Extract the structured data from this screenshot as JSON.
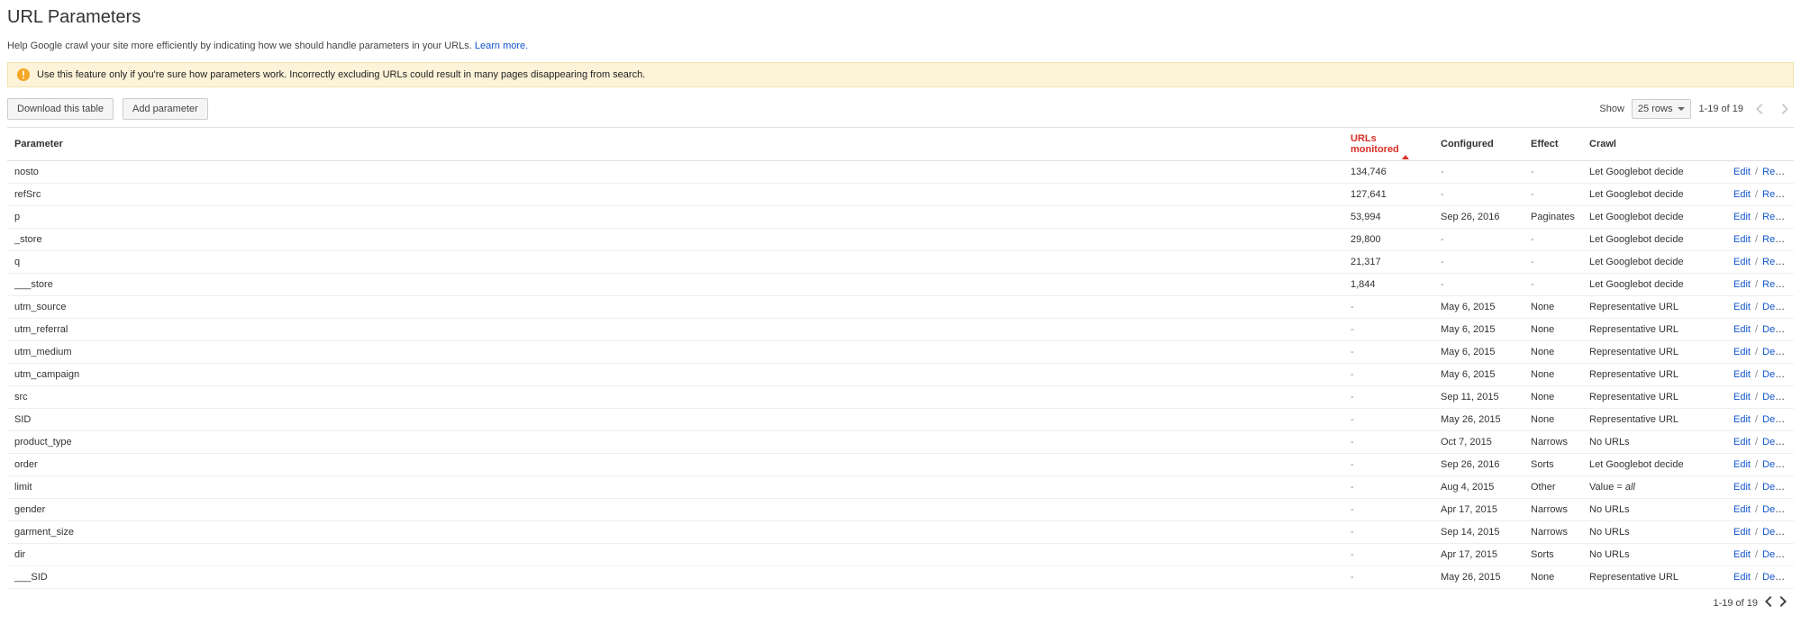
{
  "page": {
    "title": "URL Parameters",
    "intro_text": "Help Google crawl your site more efficiently by indicating how we should handle parameters in your URLs. ",
    "learn_more": "Learn more.",
    "warning": "Use this feature only if you're sure how parameters work. Incorrectly excluding URLs could result in many pages disappearing from search."
  },
  "toolbar": {
    "download": "Download this table",
    "add": "Add parameter"
  },
  "pager": {
    "show_label": "Show",
    "rows_value": "25 rows",
    "range": "1-19 of 19"
  },
  "headers": {
    "parameter": "Parameter",
    "urls_monitored": "URLs monitored",
    "configured": "Configured",
    "effect": "Effect",
    "crawl": "Crawl"
  },
  "action_labels": {
    "edit": "Edit",
    "reset": "Reset",
    "delete": "Delete",
    "sep": "/"
  },
  "crawl_value_prefix": "Value = ",
  "rows": [
    {
      "param": "nosto",
      "urls": "134,746",
      "configured": "-",
      "effect": "-",
      "crawl": "Let Googlebot decide",
      "alt": "Reset"
    },
    {
      "param": "refSrc",
      "urls": "127,641",
      "configured": "-",
      "effect": "-",
      "crawl": "Let Googlebot decide",
      "alt": "Reset"
    },
    {
      "param": "p",
      "urls": "53,994",
      "configured": "Sep 26, 2016",
      "effect": "Paginates",
      "crawl": "Let Googlebot decide",
      "alt": "Reset"
    },
    {
      "param": "_store",
      "urls": "29,800",
      "configured": "-",
      "effect": "-",
      "crawl": "Let Googlebot decide",
      "alt": "Reset"
    },
    {
      "param": "q",
      "urls": "21,317",
      "configured": "-",
      "effect": "-",
      "crawl": "Let Googlebot decide",
      "alt": "Reset"
    },
    {
      "param": "___store",
      "urls": "1,844",
      "configured": "-",
      "effect": "-",
      "crawl": "Let Googlebot decide",
      "alt": "Reset"
    },
    {
      "param": "utm_source",
      "urls": "-",
      "configured": "May 6, 2015",
      "effect": "None",
      "crawl": "Representative URL",
      "alt": "Delete"
    },
    {
      "param": "utm_referral",
      "urls": "-",
      "configured": "May 6, 2015",
      "effect": "None",
      "crawl": "Representative URL",
      "alt": "Delete"
    },
    {
      "param": "utm_medium",
      "urls": "-",
      "configured": "May 6, 2015",
      "effect": "None",
      "crawl": "Representative URL",
      "alt": "Delete"
    },
    {
      "param": "utm_campaign",
      "urls": "-",
      "configured": "May 6, 2015",
      "effect": "None",
      "crawl": "Representative URL",
      "alt": "Delete"
    },
    {
      "param": "src",
      "urls": "-",
      "configured": "Sep 11, 2015",
      "effect": "None",
      "crawl": "Representative URL",
      "alt": "Delete"
    },
    {
      "param": "SID",
      "urls": "-",
      "configured": "May 26, 2015",
      "effect": "None",
      "crawl": "Representative URL",
      "alt": "Delete"
    },
    {
      "param": "product_type",
      "urls": "-",
      "configured": "Oct 7, 2015",
      "effect": "Narrows",
      "crawl": "No URLs",
      "alt": "Delete"
    },
    {
      "param": "order",
      "urls": "-",
      "configured": "Sep 26, 2016",
      "effect": "Sorts",
      "crawl": "Let Googlebot decide",
      "alt": "Delete"
    },
    {
      "param": "limit",
      "urls": "-",
      "configured": "Aug 4, 2015",
      "effect": "Other",
      "crawl": "Value = all",
      "crawl_italic_val": "all",
      "alt": "Delete"
    },
    {
      "param": "gender",
      "urls": "-",
      "configured": "Apr 17, 2015",
      "effect": "Narrows",
      "crawl": "No URLs",
      "alt": "Delete"
    },
    {
      "param": "garment_size",
      "urls": "-",
      "configured": "Sep 14, 2015",
      "effect": "Narrows",
      "crawl": "No URLs",
      "alt": "Delete"
    },
    {
      "param": "dir",
      "urls": "-",
      "configured": "Apr 17, 2015",
      "effect": "Sorts",
      "crawl": "No URLs",
      "alt": "Delete"
    },
    {
      "param": "___SID",
      "urls": "-",
      "configured": "May 26, 2015",
      "effect": "None",
      "crawl": "Representative URL",
      "alt": "Delete"
    }
  ]
}
